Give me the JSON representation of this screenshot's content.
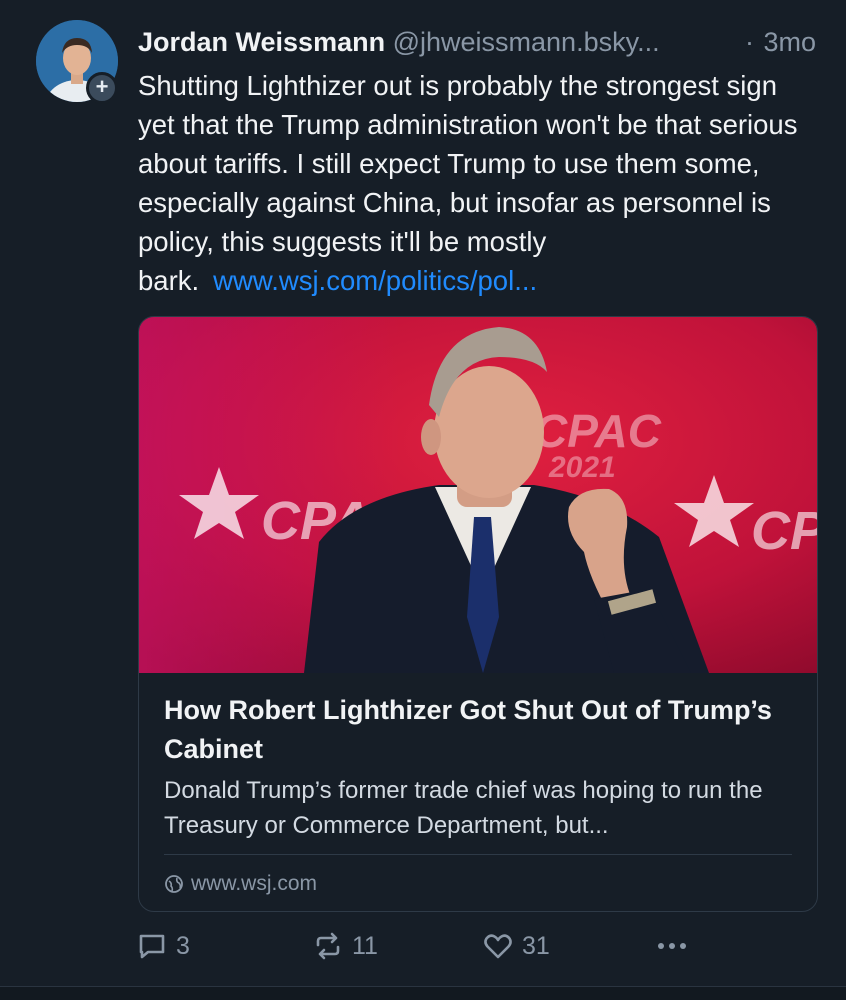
{
  "author": {
    "display_name": "Jordan Weissmann",
    "handle": "@jhweissmann.bsky...",
    "separator": "·",
    "timestamp": "3mo",
    "follow_badge": "+"
  },
  "post": {
    "text": "Shutting Lighthizer out is probably the strongest sign yet that the Trump administration won't be that serious about tariffs. I still expect Trump to use them some, especially against China, but insofar as personnel is policy, this suggests it'll be mostly bark.",
    "link_text": "www.wsj.com/politics/pol..."
  },
  "link_card": {
    "image_text_main": "CPAC",
    "image_text_year": "2021",
    "title": "How Robert Lighthizer Got Shut Out of Trump’s Cabinet",
    "description": "Donald Trump’s former trade chief was hoping to run  the Treasury or Commerce Department, but...",
    "domain": "www.wsj.com",
    "domain_icon": "globe-icon"
  },
  "actions": {
    "reply_count": "3",
    "repost_count": "11",
    "like_count": "31",
    "reply_icon": "speech-bubble-icon",
    "repost_icon": "repost-arrows-icon",
    "like_icon": "heart-icon",
    "more_icon": "ellipsis-icon"
  },
  "colors": {
    "background": "#161e27",
    "link": "#208bfe",
    "muted": "#8a97a6",
    "text": "#f1f3f5",
    "image_backdrop": "#c8143a"
  }
}
